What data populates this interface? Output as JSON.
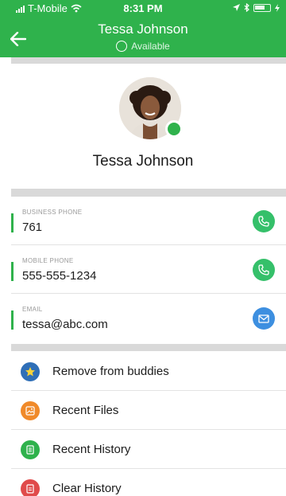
{
  "status_bar": {
    "carrier": "T-Mobile",
    "time": "8:31 PM"
  },
  "header": {
    "title": "Tessa Johnson",
    "availability": "Available"
  },
  "profile": {
    "name": "Tessa Johnson",
    "presence_color": "#2fb24c"
  },
  "contacts": [
    {
      "label": "BUSINESS PHONE",
      "value": "761",
      "action": "call",
      "icon": "phone-icon"
    },
    {
      "label": "MOBILE PHONE",
      "value": "555-555-1234",
      "action": "call",
      "icon": "phone-icon"
    },
    {
      "label": "EMAIL",
      "value": "tessa@abc.com",
      "action": "email",
      "icon": "mail-icon"
    }
  ],
  "menu": [
    {
      "label": "Remove from buddies",
      "icon": "star-icon",
      "color": "#2f6fb7"
    },
    {
      "label": "Recent Files",
      "icon": "image-icon",
      "color": "#f08a2a"
    },
    {
      "label": "Recent History",
      "icon": "history-icon",
      "color": "#2fb24c"
    },
    {
      "label": "Clear History",
      "icon": "trash-icon",
      "color": "#e04b4b"
    }
  ],
  "colors": {
    "brand_green": "#2fb24c",
    "call_green": "#35c06a",
    "email_blue": "#3d8fe0"
  }
}
